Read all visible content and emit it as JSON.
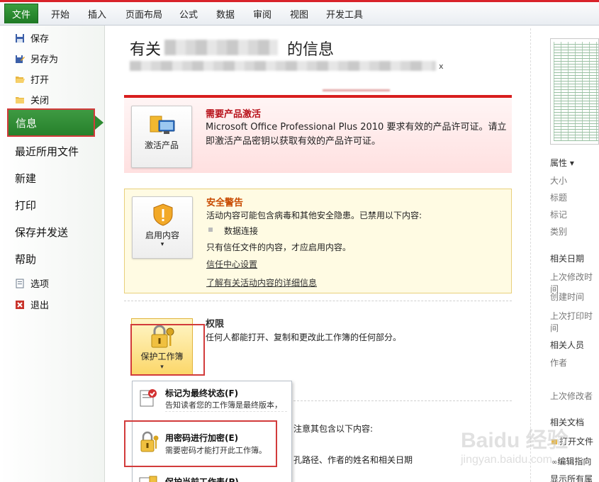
{
  "ribbon": {
    "file_tab": "文件",
    "tabs": [
      "开始",
      "插入",
      "页面布局",
      "公式",
      "数据",
      "审阅",
      "视图",
      "开发工具"
    ]
  },
  "nav": {
    "save": "保存",
    "save_as": "另存为",
    "open": "打开",
    "close": "关闭",
    "info": "信息",
    "recent": "最近所用文件",
    "new": "新建",
    "print": "打印",
    "save_send": "保存并发送",
    "help": "帮助",
    "options": "选项",
    "exit": "退出"
  },
  "main": {
    "title_prefix": "有关",
    "title_suffix": "的信息",
    "path_suffix": "x",
    "activate": {
      "button": "激活产品",
      "heading": "需要产品激活",
      "body": "Microsoft Office Professional Plus 2010 要求有效的产品许可证。请立即激活产品密钥以获取有效的产品许可证。"
    },
    "security": {
      "button": "启用内容",
      "heading": "安全警告",
      "line1": "活动内容可能包含病毒和其他安全隐患。已禁用以下内容:",
      "bullet": "数据连接",
      "line2": "只有信任文件的内容，才应启用内容。",
      "link1": "信任中心设置",
      "link2": "了解有关活动内容的详细信息"
    },
    "permissions": {
      "button": "保护工作簿",
      "heading": "权限",
      "body": "任何人都能打开、复制和更改此工作簿的任何部分。"
    },
    "prepare": {
      "partial1": "注意其包含以下内容:",
      "partial2": "孔路径、作者的姓名和相关日期"
    },
    "dropdown": {
      "item1_title": "标记为最终状态(F)",
      "item1_desc": "告知读者您的工作簿是最终版本，并将其设为只读。",
      "item2_title": "用密码进行加密(E)",
      "item2_desc": "需要密码才能打开此工作簿。",
      "item3_title": "保护当前工作表(P)"
    }
  },
  "right": {
    "properties": "属性 ▾",
    "size": "大小",
    "title": "标题",
    "tags": "标记",
    "category": "类别",
    "related_dates": "相关日期",
    "last_modified": "上次修改时间",
    "created": "创建时间",
    "last_printed": "上次打印时间",
    "related_people": "相关人员",
    "author": "作者",
    "last_modified_by": "上次修改者",
    "related_docs": "相关文档",
    "open_location": "打开文件",
    "edit_links": "编辑指向",
    "show_all": "显示所有属性"
  },
  "watermark": {
    "brand": "Baidu 经验",
    "url": "jingyan.baidu.com"
  }
}
